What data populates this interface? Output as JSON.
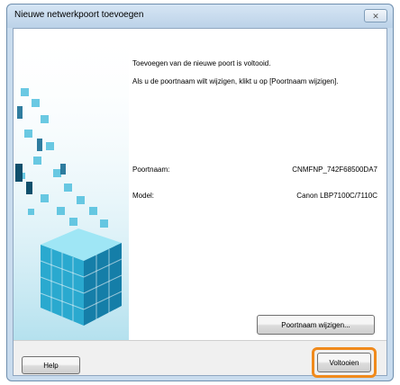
{
  "window": {
    "title": "Nieuwe netwerkpoort toevoegen",
    "close_glyph": "✕"
  },
  "message": {
    "line1": "Toevoegen van de nieuwe poort is voltooid.",
    "line2": "Als u de poortnaam wilt wijzigen, klikt u op [Poortnaam wijzigen]."
  },
  "info": {
    "port_label": "Poortnaam:",
    "port_value": "CNMFNP_742F68500DA7",
    "model_label": "Model:",
    "model_value": "Canon LBP7100C/7110C"
  },
  "buttons": {
    "rename": "Poortnaam wijzigen...",
    "help": "Help",
    "finish": "Voltooien"
  },
  "colors": {
    "highlight": "#f08a1c",
    "cube": "#2aa9cf"
  }
}
